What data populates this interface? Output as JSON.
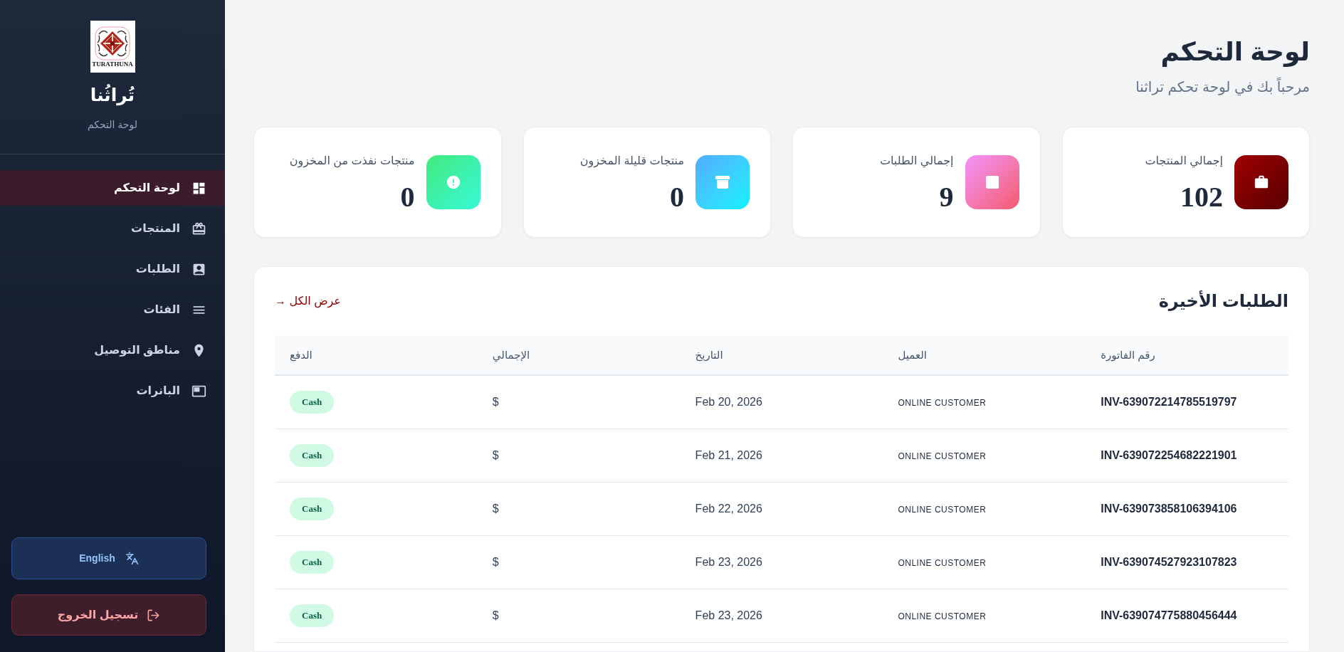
{
  "sidebar": {
    "logo": {
      "text": "TURATHUNA"
    },
    "brand": "تُراثُنا",
    "subtitle": "لوحة التحكم",
    "nav": [
      {
        "label": "لوحة التحكم",
        "kind": "dashboard",
        "selected": true
      },
      {
        "label": "المنتجات",
        "kind": "products",
        "selected": false
      },
      {
        "label": "الطلبات",
        "kind": "orders",
        "selected": false
      },
      {
        "label": "الفئات",
        "kind": "categories",
        "selected": false
      },
      {
        "label": "مناطق التوصيل",
        "kind": "zones",
        "selected": false
      },
      {
        "label": "البانرات",
        "kind": "banners",
        "selected": false
      }
    ],
    "language_button": "English",
    "logout_button": "تسجيل الخروج"
  },
  "header": {
    "title": "لوحة التحكم",
    "subtitle": "مرحباً بك في لوحة تحكم تراثنا"
  },
  "stats": [
    {
      "kind": "products",
      "label": "إجمالي المنتجات",
      "value": "102"
    },
    {
      "kind": "orders",
      "label": "إجمالي الطلبات",
      "value": "9"
    },
    {
      "kind": "low_stock",
      "label": "منتجات قليلة المخزون",
      "value": "0"
    },
    {
      "kind": "out_of_stock",
      "label": "منتجات نفذت من المخزون",
      "value": "0"
    }
  ],
  "recent_orders": {
    "title": "الطلبات الأخيرة",
    "view_all": "عرض الكل →",
    "table": {
      "columns": [
        "رقم الفاتورة",
        "العميل",
        "التاريخ",
        "الإجمالي",
        "الدفع"
      ],
      "rows": [
        {
          "invoice": "INV-639072214785519797",
          "customer": "ONLINE CUSTOMER",
          "date": "Feb 20, 2026",
          "total": "$",
          "payment": "Cash"
        },
        {
          "invoice": "INV-639072254682221901",
          "customer": "ONLINE CUSTOMER",
          "date": "Feb 21, 2026",
          "total": "$",
          "payment": "Cash"
        },
        {
          "invoice": "INV-639073858106394106",
          "customer": "ONLINE CUSTOMER",
          "date": "Feb 22, 2026",
          "total": "$",
          "payment": "Cash"
        },
        {
          "invoice": "INV-639074527923107823",
          "customer": "ONLINE CUSTOMER",
          "date": "Feb 23, 2026",
          "total": "$",
          "payment": "Cash"
        },
        {
          "invoice": "INV-639074775880456444",
          "customer": "ONLINE CUSTOMER",
          "date": "Feb 23, 2026",
          "total": "$",
          "payment": "Cash"
        }
      ]
    }
  }
}
